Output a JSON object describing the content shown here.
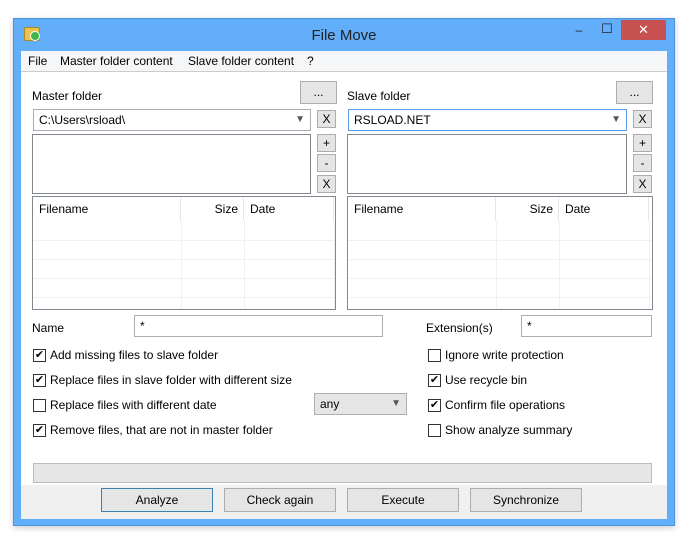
{
  "window": {
    "title": "File Move",
    "minimize": "–",
    "maximize": "☐",
    "close": "✕"
  },
  "menu": [
    "File",
    "Master folder content",
    "Slave folder content",
    "?"
  ],
  "master": {
    "label": "Master folder",
    "browse": "...",
    "path": "C:\\Users\\rsload\\",
    "clear": "X",
    "add": "+",
    "remove": "-",
    "clear_list": "X"
  },
  "slave": {
    "label": "Slave folder",
    "browse": "...",
    "path": "RSLOAD.NET",
    "clear": "X",
    "add": "+",
    "remove": "-",
    "clear_list": "X"
  },
  "columns": [
    "Filename",
    "Size",
    "Date"
  ],
  "name": {
    "label": "Name",
    "value": "*"
  },
  "extension": {
    "label": "Extension(s)",
    "value": "*"
  },
  "options_left": [
    {
      "label": "Add missing files to slave folder",
      "checked": true
    },
    {
      "label": "Replace files in slave folder with different size",
      "checked": true
    },
    {
      "label": "Replace files with different date",
      "checked": false
    },
    {
      "label": "Remove files, that are not in master folder",
      "checked": true
    }
  ],
  "date_mode": "any",
  "options_right": [
    {
      "label": "Ignore write protection",
      "checked": false
    },
    {
      "label": "Use recycle bin",
      "checked": true
    },
    {
      "label": "Confirm file operations",
      "checked": true
    },
    {
      "label": "Show analyze summary",
      "checked": false
    }
  ],
  "progress": 0,
  "buttons": {
    "analyze": "Analyze",
    "check": "Check again",
    "execute": "Execute",
    "sync": "Synchronize"
  },
  "colors": {
    "frame": "#62aefa",
    "close": "#c75050"
  }
}
